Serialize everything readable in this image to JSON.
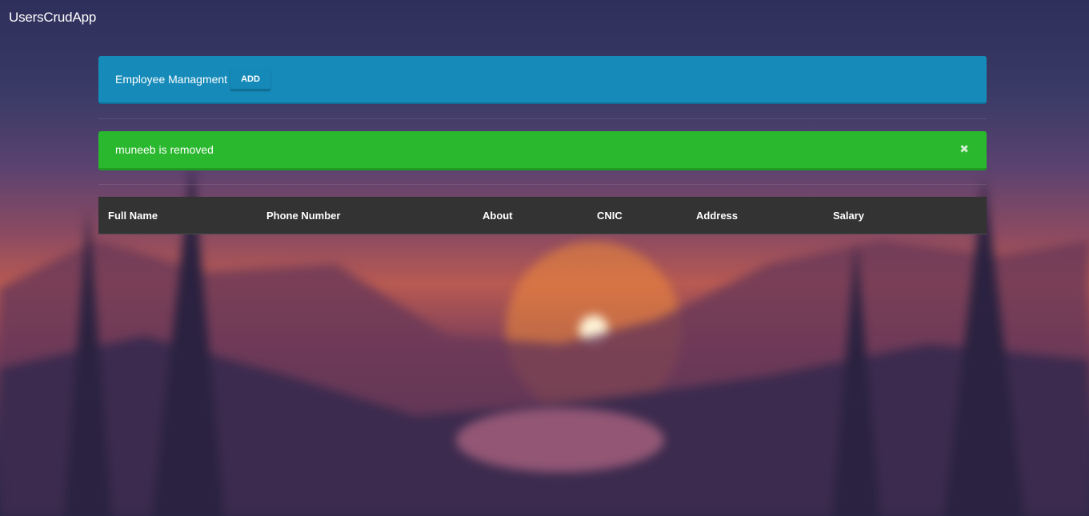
{
  "app": {
    "title": "UsersCrudApp"
  },
  "panel": {
    "title": "Employee Managment",
    "add_label": "ADD"
  },
  "alert": {
    "message": "muneeb is removed",
    "close_glyph": "✖"
  },
  "table": {
    "columns": [
      "Full Name",
      "Phone Number",
      "About",
      "CNIC",
      "Address",
      "Salary"
    ],
    "rows": []
  },
  "colors": {
    "panel_bg": "#168bba",
    "alert_bg": "#2ab82e",
    "table_head_bg": "#333333"
  }
}
